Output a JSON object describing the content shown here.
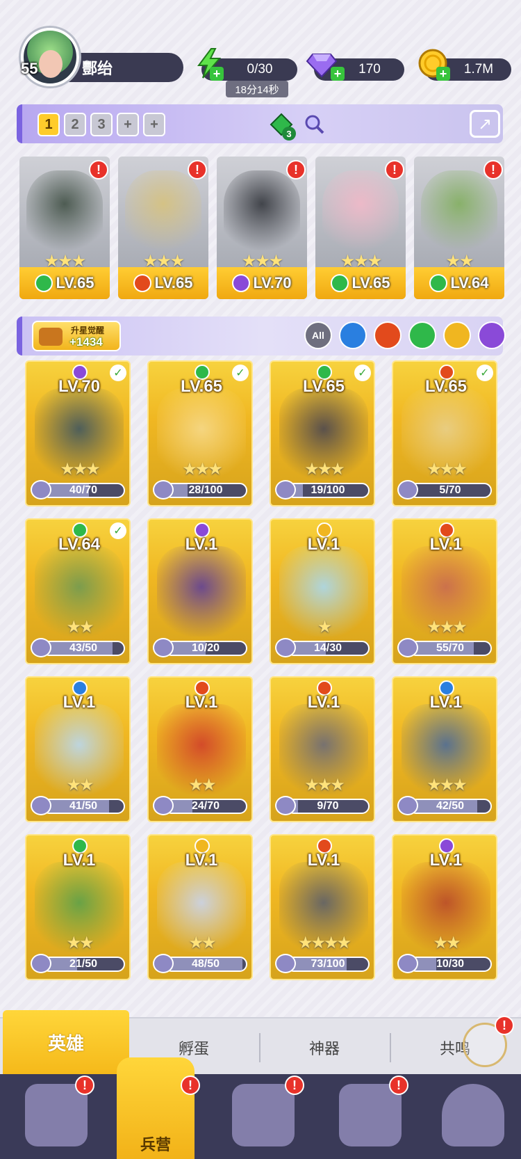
{
  "player": {
    "level": "55",
    "name": "酆绐"
  },
  "resources": {
    "energy": "0/30",
    "energy_timer": "18分14秒",
    "gems": "170",
    "coins": "1.7M"
  },
  "team": {
    "slots": [
      "1",
      "2",
      "3",
      "+",
      "+"
    ],
    "selected": "1",
    "badge_count": "3"
  },
  "lineup": [
    {
      "level": "LV.65",
      "stars": "★★★",
      "element": "wind",
      "elem_color": "#2fb84a",
      "art_color": "#3a4a3e"
    },
    {
      "level": "LV.65",
      "stars": "★★★",
      "element": "fire",
      "elem_color": "#e24a1c",
      "art_color": "#d8c27a"
    },
    {
      "level": "LV.70",
      "stars": "★★★",
      "element": "dark",
      "elem_color": "#8a4ad8",
      "art_color": "#2c2f35"
    },
    {
      "level": "LV.65",
      "stars": "★★★",
      "element": "wind",
      "elem_color": "#2fb84a",
      "art_color": "#f4b8c8"
    },
    {
      "level": "LV.64",
      "stars": "★★",
      "element": "wind",
      "elem_color": "#2fb84a",
      "art_color": "#7fae5a"
    }
  ],
  "awaken": {
    "title": "升星觉醒",
    "value": "+1434"
  },
  "filters": [
    {
      "label": "All",
      "color": "#6f6f7f"
    },
    {
      "label": "",
      "color": "#2a7fe0"
    },
    {
      "label": "",
      "color": "#e24a1c"
    },
    {
      "label": "",
      "color": "#2fb84a"
    },
    {
      "label": "",
      "color": "#f0b620"
    },
    {
      "label": "",
      "color": "#8a4ad8"
    }
  ],
  "heroes": [
    {
      "level": "LV.70",
      "stars": "★★★",
      "progress": "40/70",
      "fraction": 0.57,
      "elem_color": "#8a4ad8",
      "checked": true,
      "art_color": "#3d5560"
    },
    {
      "level": "LV.65",
      "stars": "★★★",
      "progress": "28/100",
      "fraction": 0.28,
      "elem_color": "#2fb84a",
      "checked": true,
      "art_color": "#f6d98a"
    },
    {
      "level": "LV.65",
      "stars": "★★★",
      "progress": "19/100",
      "fraction": 0.19,
      "elem_color": "#2fb84a",
      "checked": true,
      "art_color": "#4a4650"
    },
    {
      "level": "LV.65",
      "stars": "★★★",
      "progress": "5/70",
      "fraction": 0.07,
      "elem_color": "#e24a1c",
      "checked": true,
      "art_color": "#e8cf8a"
    },
    {
      "level": "LV.64",
      "stars": "★★",
      "progress": "43/50",
      "fraction": 0.86,
      "elem_color": "#2fb84a",
      "checked": true,
      "art_color": "#6f9a52"
    },
    {
      "level": "LV.1",
      "stars": "",
      "progress": "10/20",
      "fraction": 0.5,
      "elem_color": "#8a4ad8",
      "checked": false,
      "art_color": "#5e3e98"
    },
    {
      "level": "LV.1",
      "stars": "★",
      "progress": "14/30",
      "fraction": 0.47,
      "elem_color": "#f0b620",
      "checked": false,
      "art_color": "#a8d8f0"
    },
    {
      "level": "LV.1",
      "stars": "★★★",
      "progress": "55/70",
      "fraction": 0.79,
      "elem_color": "#e24a1c",
      "checked": false,
      "art_color": "#c86a50"
    },
    {
      "level": "LV.1",
      "stars": "★★",
      "progress": "41/50",
      "fraction": 0.82,
      "elem_color": "#2a7fe0",
      "checked": false,
      "art_color": "#b8d8f2"
    },
    {
      "level": "LV.1",
      "stars": "★★",
      "progress": "24/70",
      "fraction": 0.34,
      "elem_color": "#e24a1c",
      "checked": false,
      "art_color": "#d0402a"
    },
    {
      "level": "LV.1",
      "stars": "★★★",
      "progress": "9/70",
      "fraction": 0.13,
      "elem_color": "#e24a1c",
      "checked": false,
      "art_color": "#6a6a78"
    },
    {
      "level": "LV.1",
      "stars": "★★★",
      "progress": "42/50",
      "fraction": 0.84,
      "elem_color": "#2a7fe0",
      "checked": false,
      "art_color": "#4a6a9a"
    },
    {
      "level": "LV.1",
      "stars": "★★",
      "progress": "21/50",
      "fraction": 0.42,
      "elem_color": "#2fb84a",
      "checked": false,
      "art_color": "#5aa04a"
    },
    {
      "level": "LV.1",
      "stars": "★★",
      "progress": "48/50",
      "fraction": 0.96,
      "elem_color": "#f0b620",
      "checked": false,
      "art_color": "#c8d4f0"
    },
    {
      "level": "LV.1",
      "stars": "★★★★",
      "progress": "73/100",
      "fraction": 0.73,
      "elem_color": "#e24a1c",
      "checked": false,
      "art_color": "#5a5e6a"
    },
    {
      "level": "LV.1",
      "stars": "★★",
      "progress": "10/30",
      "fraction": 0.33,
      "elem_color": "#8a4ad8",
      "checked": false,
      "art_color": "#b84a2a"
    }
  ],
  "subtabs": [
    "英雄",
    "孵蛋",
    "神器",
    "共鸣"
  ],
  "bottom_nav": {
    "active_label": "兵营"
  }
}
